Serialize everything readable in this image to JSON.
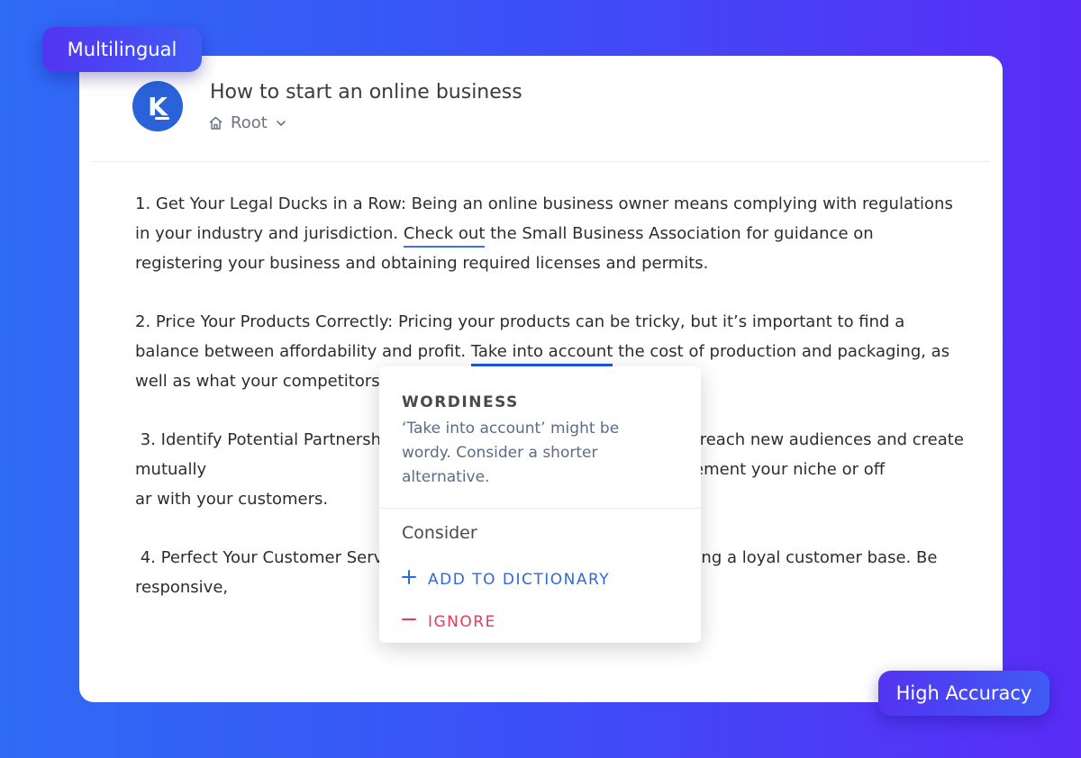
{
  "badges": {
    "top_left": "Multilingual",
    "bottom_right": "High Accuracy"
  },
  "document": {
    "logo_letter": "K",
    "title": "How to start an online business",
    "breadcrumb": {
      "icon": "home-icon",
      "label": "Root",
      "dropdown_icon": "chevron-down-icon"
    }
  },
  "paragraphs": [
    {
      "before": " 1. Get Your Legal Ducks in a Row: Being an online business owner means complying with regulations in your industry and jurisdiction. ",
      "highlight": "Check out",
      "after": " the Small Business Association for guidance on registering your business and obtaining required licenses and permits."
    },
    {
      "before": "2. Price Your Products Correctly: Pricing your products can be tricky, but it’s important to find a balance between affordability and profit. ",
      "highlight": "Take into account",
      "after": " the cost of production and packaging, as well as what your competitors"
    },
    {
      "text": " 3. Identify Potential Partnersh                                    es can help you reach new audiences and create mutually                                    tnerships with businesses that complement your niche or off                                    ar with your customers."
    },
    {
      "text": " 4. Perfect Your Customer Serv                                    e is key to building a loyal customer base. Be responsive,                                    ys put the customer first."
    }
  ],
  "suggestion_popup": {
    "category": "WORDINESS",
    "description": "‘Take into account’ might be wordy. Consider a shorter alternative.",
    "consider_label": "Consider",
    "actions": {
      "add": {
        "label": "ADD TO DICTIONARY",
        "icon": "plus-icon",
        "color": "#2f67e0"
      },
      "ignore": {
        "label": "IGNORE",
        "icon": "minus-icon",
        "color": "#e8395a"
      }
    }
  },
  "colors": {
    "accent": "#2a63d9",
    "highlight_underline": "#1d56d8",
    "background_start": "#2f6bf5",
    "background_end": "#5a2cf6"
  }
}
